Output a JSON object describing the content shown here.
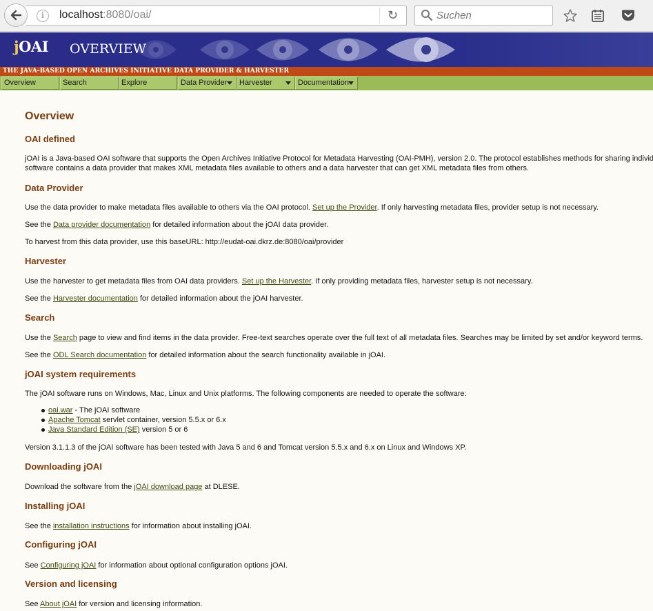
{
  "browser": {
    "url_host": "localhost",
    "url_path": ":8080/oai/",
    "search_placeholder": "Suchen"
  },
  "header": {
    "logo_prefix": "j",
    "logo_name": "OAI",
    "title": "OVERVIEW",
    "tagline": "THE JAVA-BASED OPEN ARCHIVES INITIATIVE DATA PROVIDER & HARVESTER"
  },
  "nav": [
    {
      "label": "Overview"
    },
    {
      "label": "Search"
    },
    {
      "label": "Explore"
    },
    {
      "label": "Data Provider"
    },
    {
      "label": "Harvester"
    },
    {
      "label": "Documentation"
    }
  ],
  "colors": {
    "banner": "#2a2e8c",
    "tagline_bar": "#c04a16",
    "nav_bar": "#9bbb59",
    "heading": "#7a3c10",
    "link": "#3e4a10",
    "page_bg": "#fdfbf5"
  },
  "content": {
    "page_title": "Overview",
    "oai": {
      "heading": "OAI defined",
      "line1": "jOAI is a Java-based OAI software that supports the Open Archives Initiative Protocol for Metadata Harvesting (OAI-PMH), version 2.0. The protocol establishes methods for sharing individual",
      "line2": "software contains a data provider that makes XML metadata files available to others and a data harvester that can get XML metadata files from others."
    },
    "provider": {
      "heading": "Data Provider",
      "p1_pre": "Use the data provider to make metadata files available to others via the OAI protocol. ",
      "p1_link": "Set up the Provider",
      "p1_post": ". If only harvesting metadata files, provider setup is not necessary.",
      "p2_pre": "See the ",
      "p2_link": "Data provider documentation",
      "p2_post": " for detailed information about the jOAI data provider.",
      "p3": "To harvest from this data provider, use this baseURL: http://eudat-oai.dkrz.de:8080/oai/provider"
    },
    "harvester": {
      "heading": "Harvester",
      "p1_pre": "Use the harvester to get metadata files from OAI data providers. ",
      "p1_link": "Set up the Harvester",
      "p1_post": ". If only providing metadata files, harvester setup is not necessary.",
      "p2_pre": "See the ",
      "p2_link": "Harvester documentation",
      "p2_post": " for detailed information about the jOAI harvester."
    },
    "search": {
      "heading": "Search",
      "p1_pre": "Use the ",
      "p1_link": "Search",
      "p1_post": " page to view and find items in the data provider. Free-text searches operate over the full text of all metadata files. Searches may be limited by set and/or keyword terms.",
      "p2_pre": "See the ",
      "p2_link": "ODL Search documentation",
      "p2_post": " for detailed information about the search functionality available in jOAI."
    },
    "requirements": {
      "heading": "jOAI system requirements",
      "intro": "The jOAI software runs on Windows, Mac, Linux and Unix platforms. The following components are needed to operate the software:",
      "items": [
        {
          "link": "oai.war",
          "text": " - The jOAI software"
        },
        {
          "link": "Apache Tomcat",
          "text": " servlet container, version 5.5.x or 6.x"
        },
        {
          "link": "Java Standard Edition (SE)",
          "text": " version 5 or 6"
        }
      ],
      "tested": "Version 3.1.1.3 of the jOAI software has been tested with Java 5 and 6 and Tomcat version 5.5.x and 6.x on Linux and Windows XP."
    },
    "downloading": {
      "heading": "Downloading jOAI",
      "p_pre": "Download the software from the ",
      "p_link": "jOAI download page",
      "p_post": " at DLESE."
    },
    "installing": {
      "heading": "Installing jOAI",
      "p_pre": "See the ",
      "p_link": "installation instructions",
      "p_post": " for information about installing jOAI."
    },
    "configuring": {
      "heading": "Configuring jOAI",
      "p_pre": "See ",
      "p_link": "Configuring jOAI",
      "p_post": " for information about optional configuration options jOAI."
    },
    "version": {
      "heading": "Version and licensing",
      "p_pre": "See ",
      "p_link": "About jOAI",
      "p_post": " for version and licensing information."
    }
  }
}
